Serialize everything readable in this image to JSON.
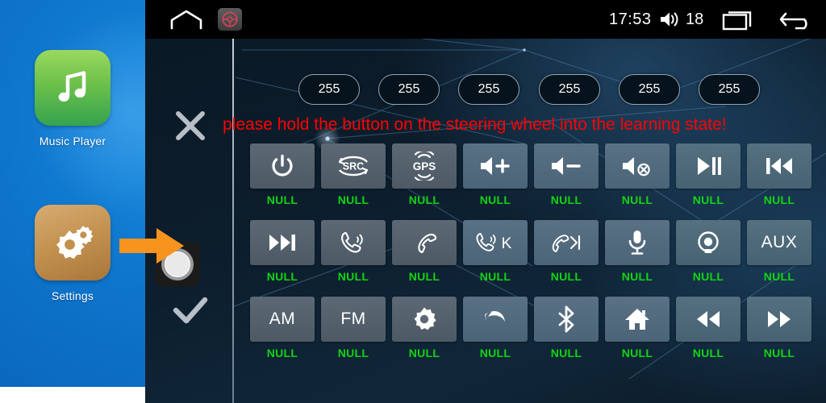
{
  "sidebar": {
    "apps": [
      {
        "label": "Music Player",
        "icon": "music-note-icon",
        "color": "#6dc04a"
      },
      {
        "label": "Settings",
        "icon": "gears-icon",
        "color": "#c2914f"
      }
    ]
  },
  "pointer": {
    "name": "orange-arrow-annotation",
    "color": "#f7941e"
  },
  "statusbar": {
    "home_icon": "home-outline-icon",
    "steering_icon": "steering-wheel-icon",
    "time": "17:53",
    "volume_icon": "volume-icon",
    "volume_level": "18",
    "recents_icon": "recents-icon",
    "back_icon": "back-arrow-icon"
  },
  "toolbar": {
    "close_icon": "close-x-icon",
    "record_icon": "circle-button-icon",
    "confirm_icon": "check-icon"
  },
  "pills": {
    "values": [
      "255",
      "255",
      "255",
      "255",
      "255",
      "255"
    ]
  },
  "warning": {
    "text": "please hold the button on the steering wheel into the learning state!",
    "color": "#ff0000"
  },
  "grid": {
    "label_color": "#12d412",
    "rows": [
      [
        {
          "icon": "power-icon",
          "text": "",
          "label": "NULL"
        },
        {
          "icon": "src-icon",
          "text": "SRC",
          "label": "NULL"
        },
        {
          "icon": "gps-icon",
          "text": "GPS",
          "label": "NULL"
        },
        {
          "icon": "volume-up-icon",
          "text": "",
          "label": "NULL"
        },
        {
          "icon": "volume-down-icon",
          "text": "",
          "label": "NULL"
        },
        {
          "icon": "mute-icon",
          "text": "",
          "label": "NULL"
        },
        {
          "icon": "play-pause-icon",
          "text": "",
          "label": "NULL"
        },
        {
          "icon": "previous-track-icon",
          "text": "",
          "label": "NULL"
        }
      ],
      [
        {
          "icon": "next-track-icon",
          "text": "",
          "label": "NULL"
        },
        {
          "icon": "answer-call-icon",
          "text": "",
          "label": "NULL"
        },
        {
          "icon": "hang-up-icon",
          "text": "",
          "label": "NULL"
        },
        {
          "icon": "call-k-icon",
          "text": "K",
          "label": "NULL"
        },
        {
          "icon": "hangup-skip-icon",
          "text": "",
          "label": "NULL"
        },
        {
          "icon": "microphone-icon",
          "text": "",
          "label": "NULL"
        },
        {
          "icon": "camera-icon",
          "text": "",
          "label": "NULL"
        },
        {
          "icon": "aux-icon",
          "text": "AUX",
          "label": "NULL"
        }
      ],
      [
        {
          "icon": "am-icon",
          "text": "AM",
          "label": "NULL"
        },
        {
          "icon": "fm-icon",
          "text": "FM",
          "label": "NULL"
        },
        {
          "icon": "gear-icon",
          "text": "",
          "label": "NULL"
        },
        {
          "icon": "back-icon",
          "text": "",
          "label": "NULL"
        },
        {
          "icon": "bluetooth-icon",
          "text": "",
          "label": "NULL"
        },
        {
          "icon": "home-icon",
          "text": "",
          "label": "NULL"
        },
        {
          "icon": "rewind-icon",
          "text": "",
          "label": "NULL"
        },
        {
          "icon": "fast-forward-icon",
          "text": "",
          "label": "NULL"
        }
      ]
    ]
  }
}
